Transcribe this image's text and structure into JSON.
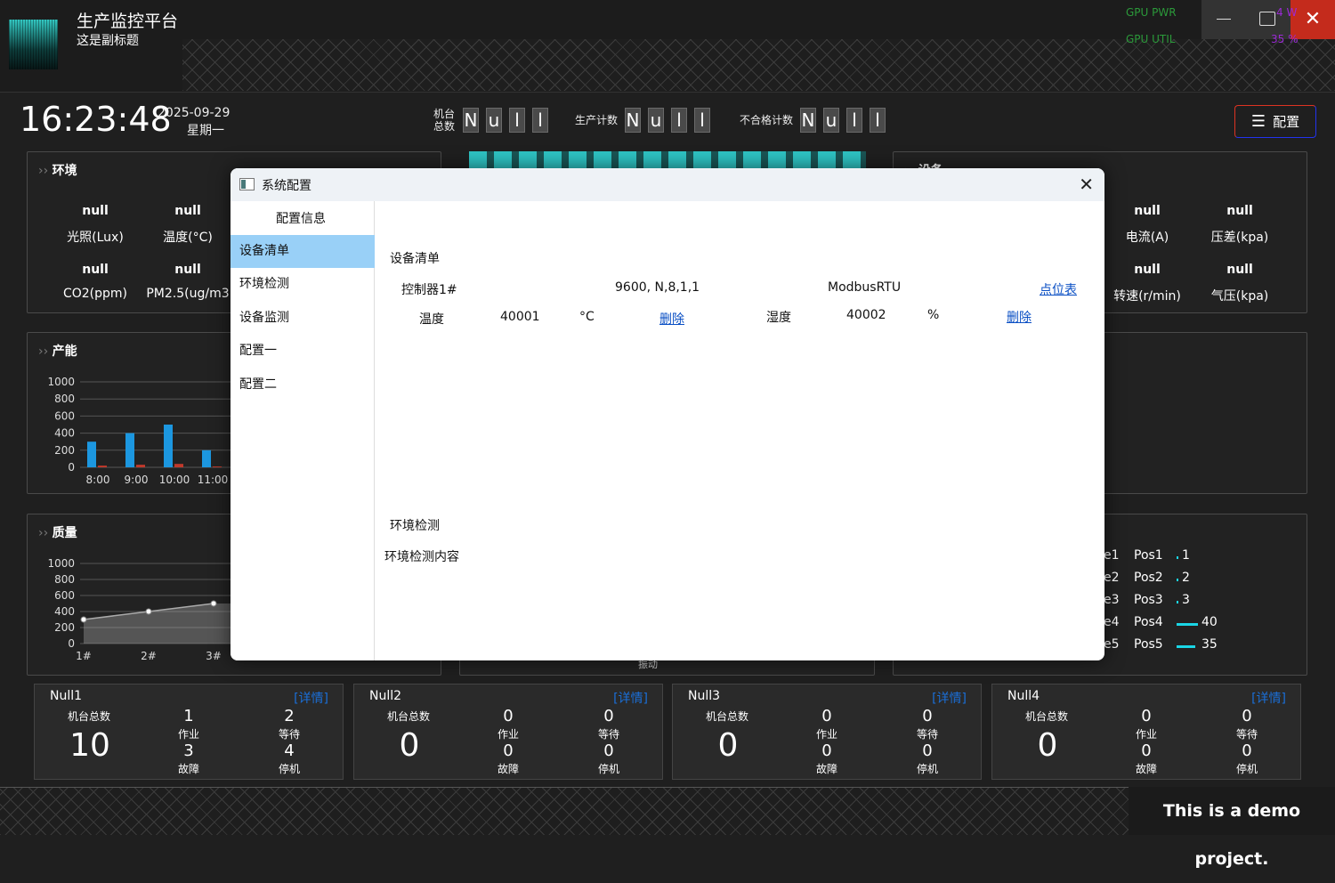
{
  "app": {
    "title": "生产监控平台",
    "subtitle": "这是副标题"
  },
  "overlay": {
    "gpu_pwr_label": "GPU PWR",
    "gpu_util_label": "GPU UTIL",
    "gpu_pwr_value": "4 W",
    "gpu_util_value": "35 %"
  },
  "clock": {
    "time": "16:23:48",
    "date": "2025-09-29",
    "weekday": "星期一"
  },
  "counters": [
    {
      "label": "机台\n总数",
      "digits": [
        "N",
        "u",
        "l",
        "l"
      ]
    },
    {
      "label": "生产计数",
      "digits": [
        "N",
        "u",
        "l",
        "l"
      ]
    },
    {
      "label": "不合格计数",
      "digits": [
        "N",
        "u",
        "l",
        "l"
      ]
    }
  ],
  "config_button": "配置",
  "env": {
    "title": "环境",
    "items": [
      {
        "value": "null",
        "label": "光照(Lux)"
      },
      {
        "value": "null",
        "label": "温度(°C)"
      },
      {
        "value": "null",
        "label": "CO2(ppm)"
      },
      {
        "value": "null",
        "label": "PM2.5(ug/m3"
      }
    ]
  },
  "device": {
    "title": "设备",
    "items": [
      {
        "value": "null",
        "label": "电流(A)"
      },
      {
        "value": "null",
        "label": "压差(kpa)"
      },
      {
        "value": "null",
        "label": "转速(r/min)"
      },
      {
        "value": "null",
        "label": "气压(kpa)"
      }
    ]
  },
  "capacity": {
    "title": "产能"
  },
  "quality": {
    "title": "质量"
  },
  "chart_data": [
    {
      "type": "bar",
      "title": "产能",
      "categories": [
        "8:00",
        "9:00",
        "10:00",
        "11:00"
      ],
      "ylim": [
        0,
        1000
      ],
      "yticks": [
        "1000",
        "800",
        "600",
        "400",
        "200",
        "0"
      ],
      "series": [
        {
          "values": [
            300,
            400,
            500,
            200
          ]
        },
        {
          "values": [
            20,
            30,
            40,
            10
          ]
        }
      ]
    },
    {
      "type": "area",
      "title": "质量",
      "categories": [
        "1#",
        "2#",
        "3#"
      ],
      "ylim": [
        0,
        1000
      ],
      "yticks": [
        "1000",
        "800",
        "600",
        "400",
        "200",
        "0"
      ],
      "series": [
        {
          "values": [
            300,
            400,
            500
          ]
        }
      ]
    }
  ],
  "pos_list": [
    {
      "name": "e1",
      "pos": "Pos1",
      "value": "1"
    },
    {
      "name": "e2",
      "pos": "Pos2",
      "value": "2"
    },
    {
      "name": "e3",
      "pos": "Pos3",
      "value": "3"
    },
    {
      "name": "e4",
      "pos": "Pos4",
      "value": "40"
    },
    {
      "name": "e5",
      "pos": "Pos5",
      "value": "35"
    }
  ],
  "vibration_label": "振动",
  "cards": [
    {
      "name": "Null1",
      "detail": "[详情]",
      "total_label": "机台总数",
      "total": "10",
      "work": "1",
      "work_label": "作业",
      "wait": "2",
      "wait_label": "等待",
      "fault": "3",
      "fault_label": "故障",
      "stop": "4",
      "stop_label": "停机"
    },
    {
      "name": "Null2",
      "detail": "[详情]",
      "total_label": "机台总数",
      "total": "0",
      "work": "0",
      "work_label": "作业",
      "wait": "0",
      "wait_label": "等待",
      "fault": "0",
      "fault_label": "故障",
      "stop": "0",
      "stop_label": "停机"
    },
    {
      "name": "Null3",
      "detail": "[详情]",
      "total_label": "机台总数",
      "total": "0",
      "work": "0",
      "work_label": "作业",
      "wait": "0",
      "wait_label": "等待",
      "fault": "0",
      "fault_label": "故障",
      "stop": "0",
      "stop_label": "停机"
    },
    {
      "name": "Null4",
      "detail": "[详情]",
      "total_label": "机台总数",
      "total": "0",
      "work": "0",
      "work_label": "作业",
      "wait": "0",
      "wait_label": "等待",
      "fault": "0",
      "fault_label": "故障",
      "stop": "0",
      "stop_label": "停机"
    }
  ],
  "footer_note": "This is a demo project.",
  "dialog": {
    "title": "系统配置",
    "sidebar_header": "配置信息",
    "nav": [
      "设备清单",
      "环境检测",
      "设备监测",
      "配置一",
      "配置二"
    ],
    "device_section": "设备清单",
    "controller": {
      "name": "控制器1#",
      "params": "9600, N,8,1,1",
      "protocol": "ModbusRTU",
      "link": "点位表"
    },
    "points": [
      {
        "name": "温度",
        "addr": "40001",
        "unit": "°C",
        "action": "删除"
      },
      {
        "name": "湿度",
        "addr": "40002",
        "unit": "%",
        "action": "删除"
      }
    ],
    "env_section": "环境检测",
    "env_content": "环境检测内容"
  }
}
